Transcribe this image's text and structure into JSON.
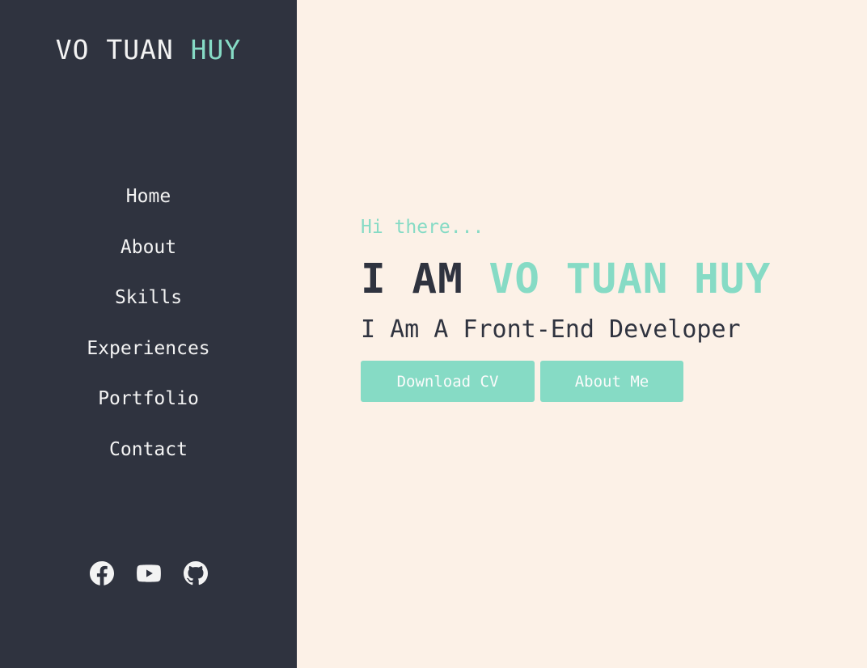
{
  "sidebar": {
    "logo": {
      "name": "VO TUAN",
      "accent": "HUY"
    },
    "nav": [
      "Home",
      "About",
      "Skills",
      "Experiences",
      "Portfolio",
      "Contact"
    ],
    "social_icons": [
      "facebook-icon",
      "youtube-icon",
      "github-icon"
    ]
  },
  "hero": {
    "greeting": "Hi there...",
    "headline_prefix": "I AM",
    "headline_name": "VO TUAN HUY",
    "subtitle": "I Am A Front-End Developer",
    "buttons": {
      "download_cv": "Download CV",
      "about_me": "About Me"
    }
  },
  "colors": {
    "sidebar_bg": "#2f333f",
    "main_bg": "#fcf1e7",
    "accent": "#86dbc5",
    "text_light": "#f3f3f3",
    "text_dark": "#2f333f"
  }
}
